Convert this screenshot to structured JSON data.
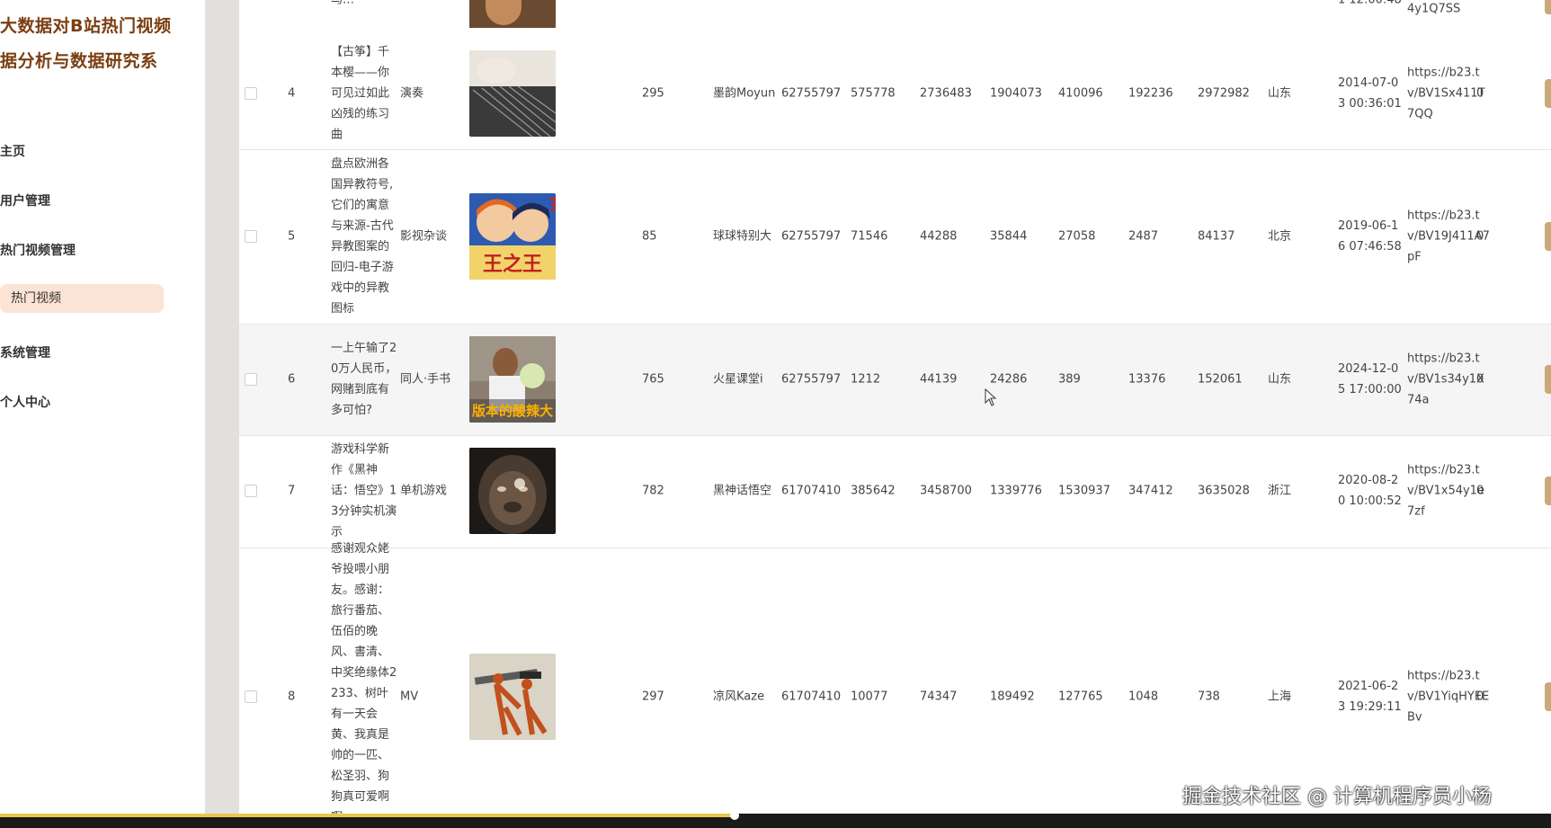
{
  "sidebar": {
    "brand_line1": "大数据对B站热门视频",
    "brand_line2": "据分析与数据研究系",
    "menu": [
      {
        "label": "主页"
      },
      {
        "label": "用户管理"
      },
      {
        "label": "热门视频管理"
      },
      {
        "label": "系统管理"
      },
      {
        "label": "个人中心"
      }
    ],
    "submenu_active": "热门视频"
  },
  "top_partial": {
    "title": "马…",
    "date": "1 12:00:48",
    "url": "4y1Q7SS"
  },
  "rows": [
    {
      "index": "4",
      "title": "【古筝】千本樱——你可见过如此凶残的练习曲",
      "category": "演奏",
      "duration": "295",
      "author": "墨韵Moyun",
      "uid": "62755797",
      "c1": "575778",
      "c2": "2736483",
      "c3": "1904073",
      "c4": "410096",
      "c5": "192236",
      "c6": "2972982",
      "region": "山东",
      "date": "2014-07-03 00:36:01",
      "url": "https://b23.tv/BV1Sx411T7QQ",
      "flag": "0",
      "thumb_icon": "guzheng-thumbnail"
    },
    {
      "index": "5",
      "title": "盘点欧洲各国异教符号,它们的寓意与来源-古代异教图案的回归-电子游戏中的异教图标",
      "category": "影视杂谈",
      "duration": "85",
      "author": "球球特别大",
      "uid": "62755797",
      "c1": "71546",
      "c2": "44288",
      "c3": "35844",
      "c4": "27058",
      "c5": "2487",
      "c6": "84137",
      "region": "北京",
      "date": "2019-06-16 07:46:58",
      "url": "https://b23.tv/BV19J411A7pF",
      "flag": "0",
      "thumb_icon": "cartoon-thumbnail",
      "thumb_text": "王之王"
    },
    {
      "index": "6",
      "title": "一上午输了20万人民币，网赌到底有多可怕?",
      "category": "同人·手书",
      "duration": "765",
      "author": "火星课堂i",
      "uid": "62755797",
      "c1": "1212",
      "c2": "44139",
      "c3": "24286",
      "c4": "389",
      "c5": "13376",
      "c6": "152061",
      "region": "山东",
      "date": "2024-12-05 17:00:00",
      "url": "https://b23.tv/BV1s34y1X74a",
      "flag": "0",
      "thumb_icon": "chef-thumbnail",
      "thumb_text": "版本的酸辣大"
    },
    {
      "index": "7",
      "title": "游戏科学新作《黑神话：悟空》13分钟实机演示",
      "category": "单机游戏",
      "duration": "782",
      "author": "黑神话悟空",
      "uid": "61707410",
      "c1": "385642",
      "c2": "3458700",
      "c3": "1339776",
      "c4": "1530937",
      "c5": "347412",
      "c6": "3635028",
      "region": "浙江",
      "date": "2020-08-20 10:00:52",
      "url": "https://b23.tv/BV1x54y1e7zf",
      "flag": "0",
      "thumb_icon": "wukong-thumbnail"
    },
    {
      "index": "8",
      "title": "感谢观众姥爷投喂小朋友。感谢：旅行番茄、伍佰的晚风、書清、中奖绝缘体2233、树叶有一天会黄、我真是帅的一匹、松圣羽、狗狗真可爱啊啊",
      "category": "MV",
      "duration": "297",
      "author": "凉风Kaze",
      "uid": "61707410",
      "c1": "10077",
      "c2": "74347",
      "c3": "189492",
      "c4": "127765",
      "c5": "1048",
      "c6": "738",
      "region": "上海",
      "date": "2021-06-23 19:29:11",
      "url": "https://b23.tv/BV1YiqHYEEBv",
      "flag": "0",
      "thumb_icon": "egyptian-thumbnail"
    }
  ],
  "watermark": "掘金技术社区 @ 计算机程序员小杨",
  "colors": {
    "brand": "#7a3e12",
    "active_submenu_bg": "#fbe3d6",
    "op_button": "#c9a97a",
    "progress": "#e8c848"
  }
}
